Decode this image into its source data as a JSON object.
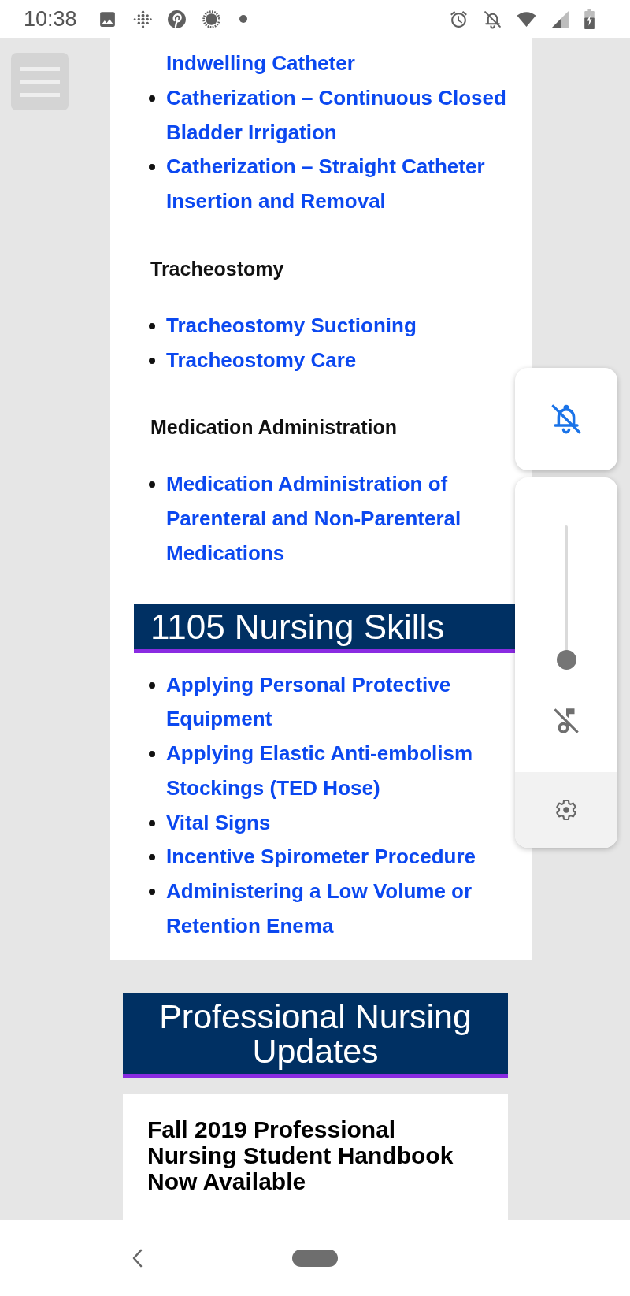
{
  "status_bar": {
    "time": "10:38"
  },
  "article": {
    "blocks": [
      {
        "kind": "list",
        "items": [
          {
            "kind": "continued",
            "text": "Indwelling Catheter"
          },
          {
            "kind": "bullet",
            "text": "Catherization – Continuous Closed Bladder Irrigation"
          },
          {
            "kind": "bullet",
            "text": "Catherization – Straight Catheter Insertion and Removal"
          }
        ]
      },
      {
        "kind": "subheading",
        "text": "Tracheostomy"
      },
      {
        "kind": "list",
        "items": [
          {
            "kind": "bullet",
            "text": "Tracheostomy Suctioning"
          },
          {
            "kind": "bullet",
            "text": "Tracheostomy Care"
          }
        ]
      },
      {
        "kind": "subheading",
        "text": "Medication Administration"
      },
      {
        "kind": "list",
        "items": [
          {
            "kind": "bullet",
            "text": "Medication Administration of Parenteral and Non-Parenteral Medications"
          }
        ]
      },
      {
        "kind": "banner",
        "text": "1105 Nursing Skills"
      },
      {
        "kind": "list",
        "items": [
          {
            "kind": "bullet",
            "text": "Applying Personal Protective Equipment"
          },
          {
            "kind": "bullet",
            "text": "Applying Elastic Anti-embolism Stockings (TED Hose)"
          },
          {
            "kind": "bullet",
            "text": "Vital Signs"
          },
          {
            "kind": "bullet",
            "text": "Incentive Spirometer Procedure"
          },
          {
            "kind": "bullet",
            "text": "Administering a Low Volume or Retention Enema"
          }
        ]
      }
    ]
  },
  "updates": {
    "title": "Professional Nursing Updates",
    "posts": [
      {
        "title": "Fall 2019 Professional Nursing Student Handbook Now Available"
      }
    ]
  },
  "volume_panel": {
    "ringer_muted": true,
    "slider": {
      "level": 0,
      "muted": true
    }
  }
}
